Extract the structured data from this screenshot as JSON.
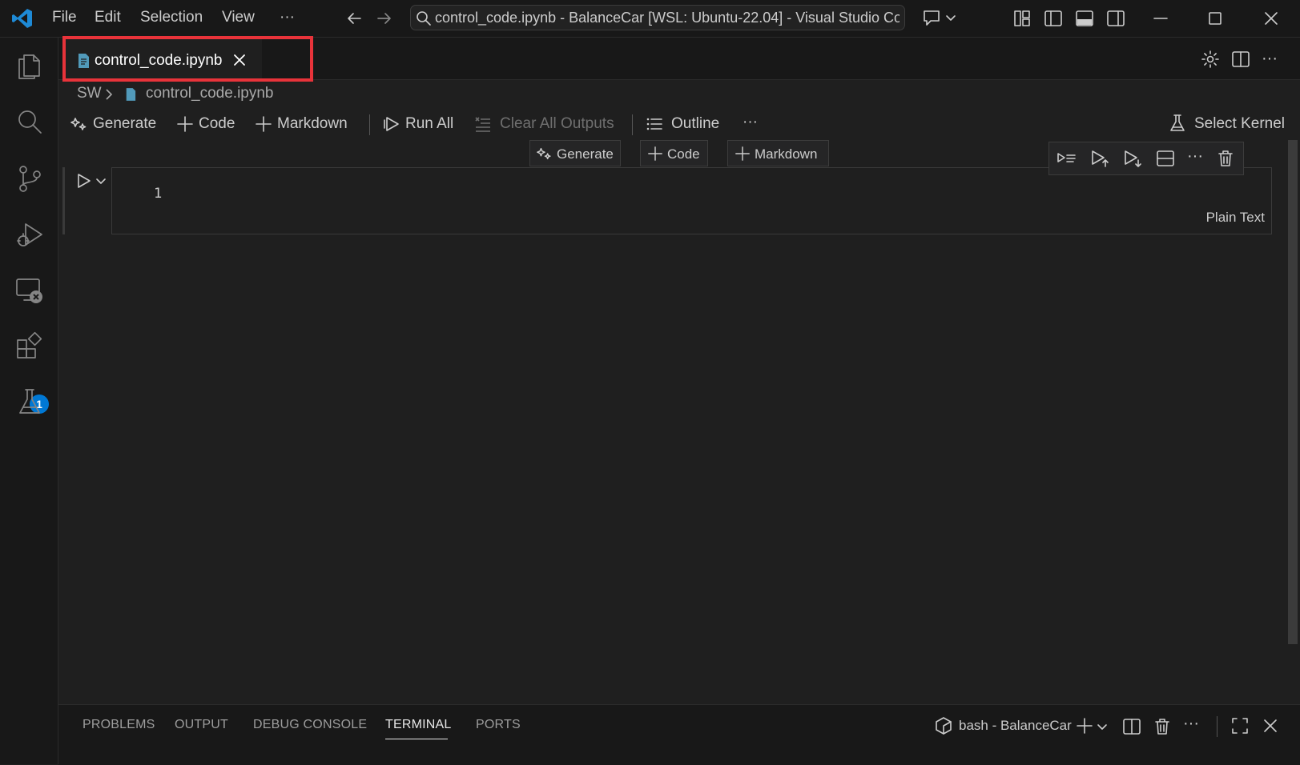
{
  "titlebar": {
    "menu": [
      "File",
      "Edit",
      "Selection",
      "View",
      "···"
    ],
    "command_center": "control_code.ipynb - BalanceCar [WSL: Ubuntu-22.04] - Visual Studio Code"
  },
  "activity_bar": {
    "extensions_badge": "1"
  },
  "editor_tabs": [
    {
      "label": "control_code.ipynb",
      "active": true
    }
  ],
  "breadcrumb": {
    "folder": "SW",
    "file": "control_code.ipynb"
  },
  "notebook_toolbar": {
    "generate": "Generate",
    "code": "Code",
    "markdown": "Markdown",
    "run_all": "Run All",
    "clear_outputs": "Clear All Outputs",
    "outline": "Outline",
    "more": "···",
    "select_kernel": "Select Kernel"
  },
  "insert_cell_toolbar": {
    "generate": "Generate",
    "code": "Code",
    "markdown": "Markdown"
  },
  "cell": {
    "line_number": "1",
    "language": "Plain Text"
  },
  "panel": {
    "tabs": [
      "PROBLEMS",
      "OUTPUT",
      "DEBUG CONSOLE",
      "TERMINAL",
      "PORTS"
    ],
    "active_tab": "TERMINAL",
    "terminal_name": "bash - BalanceCar"
  },
  "colors": {
    "accent": "#0078d4",
    "highlight_box": "#e8333a",
    "background": "#1f1f1f"
  }
}
